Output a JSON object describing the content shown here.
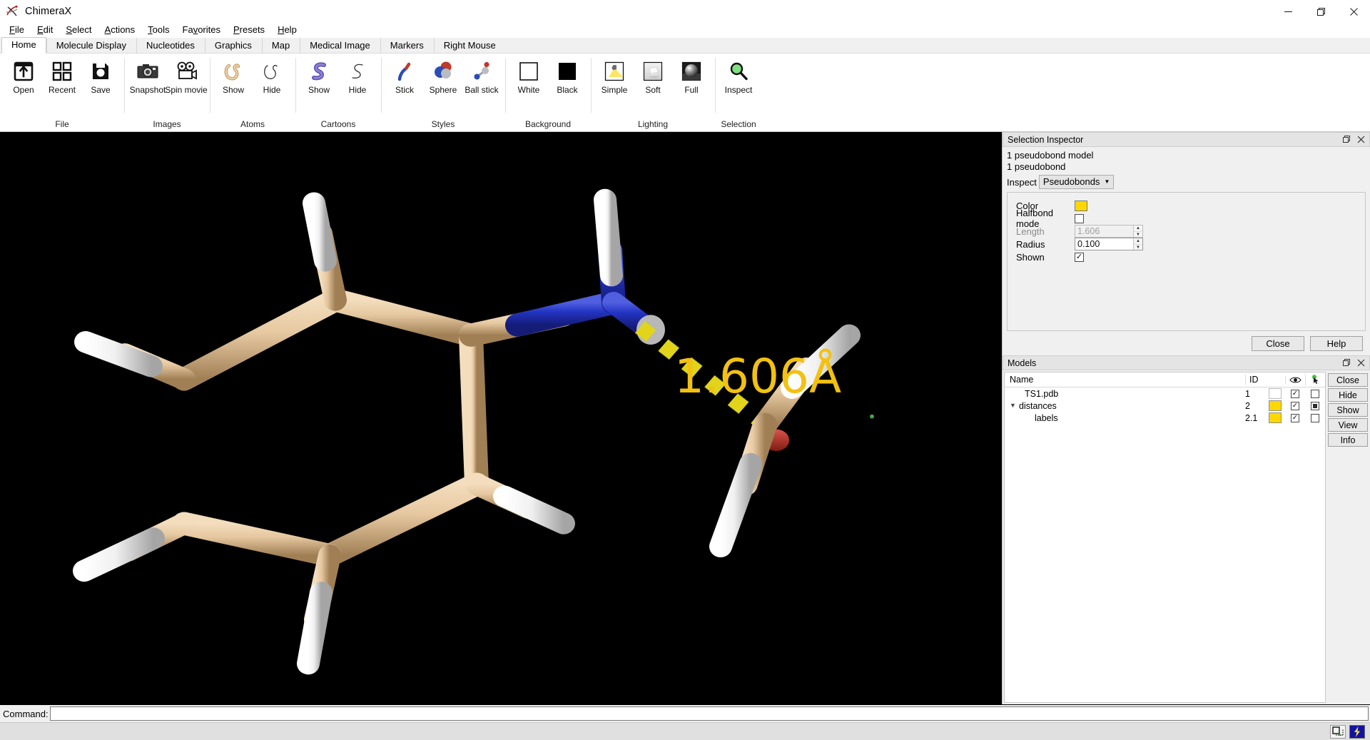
{
  "window": {
    "title": "ChimeraX",
    "minimize": "—",
    "maximize": "❐",
    "close": "✕"
  },
  "menubar": {
    "items": [
      {
        "label": "File",
        "mnemonic": "F"
      },
      {
        "label": "Edit",
        "mnemonic": "E"
      },
      {
        "label": "Select",
        "mnemonic": "S"
      },
      {
        "label": "Actions",
        "mnemonic": "A"
      },
      {
        "label": "Tools",
        "mnemonic": "T"
      },
      {
        "label": "Favorites",
        "mnemonic": "v"
      },
      {
        "label": "Presets",
        "mnemonic": "P"
      },
      {
        "label": "Help",
        "mnemonic": "H"
      }
    ]
  },
  "ribbon": {
    "tabs": [
      {
        "label": "Home",
        "active": true
      },
      {
        "label": "Molecule Display",
        "active": false
      },
      {
        "label": "Nucleotides",
        "active": false
      },
      {
        "label": "Graphics",
        "active": false
      },
      {
        "label": "Map",
        "active": false
      },
      {
        "label": "Medical Image",
        "active": false
      },
      {
        "label": "Markers",
        "active": false
      },
      {
        "label": "Right Mouse",
        "active": false
      }
    ],
    "groups": [
      {
        "name": "File",
        "buttons": [
          {
            "label": "Open",
            "icon": "open-folder-icon"
          },
          {
            "label": "Recent",
            "icon": "recent-grid-icon"
          },
          {
            "label": "Save",
            "icon": "save-floppy-icon"
          }
        ]
      },
      {
        "name": "Images",
        "buttons": [
          {
            "label": "Snapshot",
            "icon": "camera-icon"
          },
          {
            "label": "Spin movie",
            "icon": "movie-camera-icon"
          }
        ]
      },
      {
        "name": "Atoms",
        "buttons": [
          {
            "label": "Show",
            "icon": "atoms-show-icon"
          },
          {
            "label": "Hide",
            "icon": "atoms-hide-icon"
          }
        ]
      },
      {
        "name": "Cartoons",
        "buttons": [
          {
            "label": "Show",
            "icon": "cartoon-show-icon"
          },
          {
            "label": "Hide",
            "icon": "cartoon-hide-icon"
          }
        ]
      },
      {
        "name": "Styles",
        "buttons": [
          {
            "label": "Stick",
            "icon": "stick-style-icon"
          },
          {
            "label": "Sphere",
            "icon": "sphere-style-icon"
          },
          {
            "label": "Ball stick",
            "icon": "ballstick-style-icon"
          }
        ]
      },
      {
        "name": "Background",
        "buttons": [
          {
            "label": "White",
            "icon": "white-square-icon"
          },
          {
            "label": "Black",
            "icon": "black-square-icon"
          }
        ]
      },
      {
        "name": "Lighting",
        "buttons": [
          {
            "label": "Simple",
            "icon": "lighting-simple-icon"
          },
          {
            "label": "Soft",
            "icon": "lighting-soft-icon"
          },
          {
            "label": "Full",
            "icon": "lighting-full-icon"
          }
        ]
      },
      {
        "name": "Selection",
        "buttons": [
          {
            "label": "Inspect",
            "icon": "magnifier-icon"
          }
        ]
      }
    ]
  },
  "viewport": {
    "background_color": "#000000",
    "distance_label": "1.606Å",
    "label_color": "#f2c111",
    "carbon_color": "#e8cfa5",
    "hydrogen_color": "#ffffff",
    "nitrogen_color": "#2434c4",
    "oxygen_color": "#b03024",
    "pseudobond_color": "#ffd700"
  },
  "selection_inspector": {
    "title": "Selection Inspector",
    "float_icon": "❐",
    "close_icon": "✕",
    "summary_line1": "1 pseudobond model",
    "summary_line2": "1 pseudobond",
    "inspect_label": "Inspect",
    "inspect_value": "Pseudobonds",
    "fields": [
      {
        "label": "Color",
        "type": "color",
        "value": "#ffd700"
      },
      {
        "label": "Halfbond mode",
        "type": "checkbox",
        "checked": false
      },
      {
        "label": "Length",
        "type": "spin",
        "value": "1.606",
        "disabled": true
      },
      {
        "label": "Radius",
        "type": "spin",
        "value": "0.100",
        "disabled": false
      },
      {
        "label": "Shown",
        "type": "checkbox",
        "checked": true
      }
    ],
    "buttons": [
      {
        "label": "Close"
      },
      {
        "label": "Help"
      }
    ]
  },
  "models_panel": {
    "title": "Models",
    "float_icon": "❐",
    "close_icon": "✕",
    "columns": {
      "name": "Name",
      "id": "ID",
      "color": "",
      "shown": "eye-icon",
      "select": "select-pointer-icon"
    },
    "rows": [
      {
        "name": "TS1.pdb",
        "id": "1",
        "color": "",
        "shown": true,
        "selected": "none",
        "indent": 1,
        "twisty": ""
      },
      {
        "name": "distances",
        "id": "2",
        "color": "#ffd700",
        "shown": true,
        "selected": "partial",
        "indent": 0,
        "twisty": "⌄"
      },
      {
        "name": "labels",
        "id": "2.1",
        "color": "#ffd700",
        "shown": true,
        "selected": "none",
        "indent": 2,
        "twisty": ""
      }
    ],
    "buttons": [
      {
        "label": "Close"
      },
      {
        "label": "Hide"
      },
      {
        "label": "Show"
      },
      {
        "label": "View"
      },
      {
        "label": "Info"
      }
    ]
  },
  "command_bar": {
    "label": "Command:",
    "value": "",
    "placeholder": ""
  },
  "status_bar": {
    "text": "",
    "icons": [
      {
        "name": "select-region-icon"
      },
      {
        "name": "lightning-icon"
      }
    ]
  }
}
